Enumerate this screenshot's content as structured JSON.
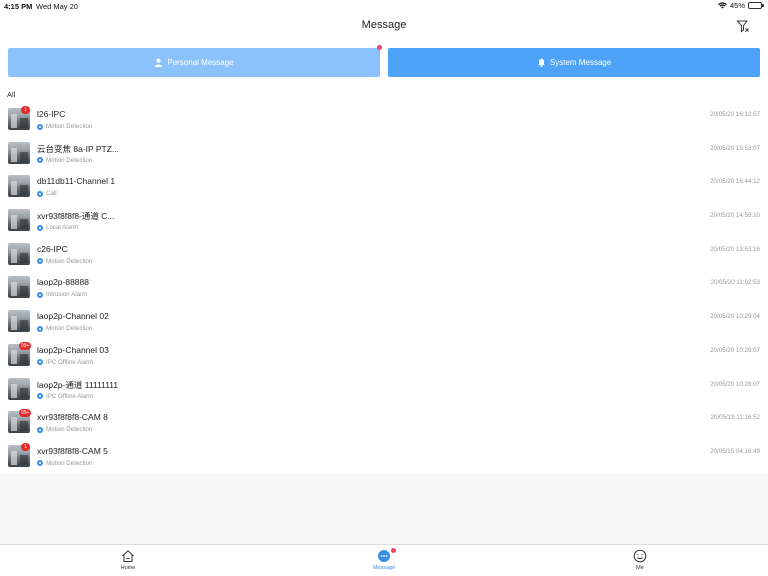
{
  "status_bar": {
    "time": "4:15 PM",
    "date": "Wed May 20",
    "battery": "45%",
    "battery_level": 0.45
  },
  "header": {
    "title": "Message",
    "filter_icon": "filter-icon"
  },
  "segments": {
    "personal_label": "Personal Message",
    "system_label": "System Message",
    "personal_icon": "person-icon",
    "system_icon": "bell-icon"
  },
  "filter": {
    "label": "All"
  },
  "messages": [
    {
      "name": "l26-IPC",
      "type": "Motion Detection",
      "time": "20/05/20 16:12:57",
      "badge": "1"
    },
    {
      "name": "云台变焦 8a-IP PTZ...",
      "type": "Motion Detection",
      "time": "20/05/20 15:53:07",
      "badge": ""
    },
    {
      "name": "db11db11-Channel 1",
      "type": "Call",
      "time": "20/05/20 16:44:12",
      "badge": ""
    },
    {
      "name": "xvr93f8f8f8-通道 C...",
      "type": "Local Alarm",
      "time": "20/05/20 14:59:10",
      "badge": ""
    },
    {
      "name": "c26-IPC",
      "type": "Motion Detection",
      "time": "20/05/20 13:53:16",
      "badge": ""
    },
    {
      "name": "laop2p-88888",
      "type": "Intrusion Alarm",
      "time": "20/05/20 11:02:53",
      "badge": ""
    },
    {
      "name": "laop2p-Channel 02",
      "type": "Motion Detection",
      "time": "20/05/20 10:29:04",
      "badge": ""
    },
    {
      "name": "laop2p-Channel 03",
      "type": "IPC Offline Alarm",
      "time": "20/05/20 10:29:07",
      "badge": "99+"
    },
    {
      "name": "laop2p-通道 11111111",
      "type": "IPC Offline Alarm",
      "time": "20/05/20 10:28:07",
      "badge": ""
    },
    {
      "name": "xvr93f8f8f8-CAM 8",
      "type": "Motion Detection",
      "time": "20/05/19 11:16:52",
      "badge": "99+"
    },
    {
      "name": "xvr93f8f8f8-CAM 5",
      "type": "Motion Detection",
      "time": "20/05/15 04:16:49",
      "badge": "1"
    }
  ],
  "tabbar": {
    "home_label": "Home",
    "message_label": "Message",
    "me_label": "Me",
    "accent": "#3a8ee8"
  }
}
